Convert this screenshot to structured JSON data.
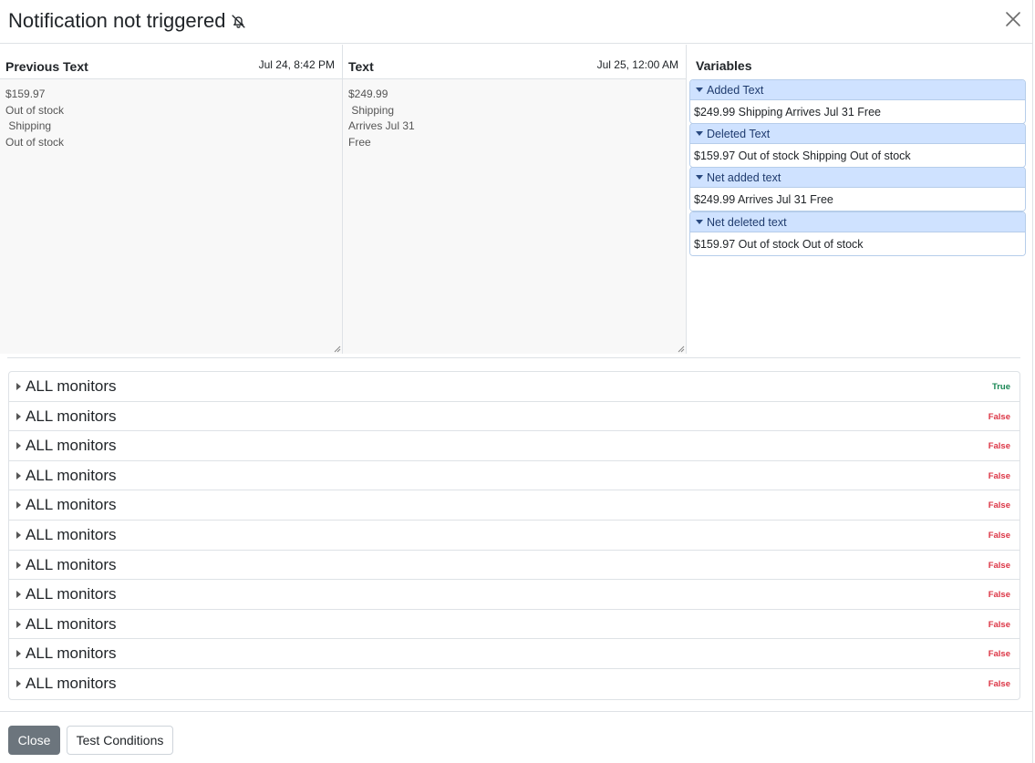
{
  "header": {
    "title": "Notification not triggered",
    "bell_icon": "bell-slash-icon",
    "close_icon": "close-icon"
  },
  "previous": {
    "title": "Previous Text",
    "date": "Jul 24, 8:42 PM",
    "lines": [
      "$159.97",
      "Out of stock",
      " Shipping",
      "Out of stock"
    ]
  },
  "current": {
    "title": "Text",
    "date": "Jul 25, 12:00 AM",
    "lines": [
      "$249.99",
      " Shipping",
      "Arrives Jul 31",
      "Free"
    ]
  },
  "variables": {
    "title": "Variables",
    "cards": [
      {
        "label": "Added Text",
        "value": "$249.99 Shipping Arrives Jul 31 Free"
      },
      {
        "label": "Deleted Text",
        "value": "$159.97 Out of stock Shipping Out of stock"
      },
      {
        "label": "Net added text",
        "value": "$249.99 Arrives Jul 31 Free"
      },
      {
        "label": "Net deleted text",
        "value": "$159.97 Out of stock Out of stock"
      }
    ]
  },
  "conditions": [
    {
      "label": "ALL monitors",
      "status": "True"
    },
    {
      "label": "ALL monitors",
      "status": "False"
    },
    {
      "label": "ALL monitors",
      "status": "False"
    },
    {
      "label": "ALL monitors",
      "status": "False"
    },
    {
      "label": "ALL monitors",
      "status": "False"
    },
    {
      "label": "ALL monitors",
      "status": "False"
    },
    {
      "label": "ALL monitors",
      "status": "False"
    },
    {
      "label": "ALL monitors",
      "status": "False"
    },
    {
      "label": "ALL monitors",
      "status": "False"
    },
    {
      "label": "ALL monitors",
      "status": "False"
    },
    {
      "label": "ALL monitors",
      "status": "False"
    }
  ],
  "colors": {
    "true": "#198754",
    "false": "#dc3545",
    "card_header": "#cfe2ff",
    "secondary_button": "#6c757d"
  },
  "footer": {
    "close_label": "Close",
    "test_label": "Test Conditions"
  }
}
